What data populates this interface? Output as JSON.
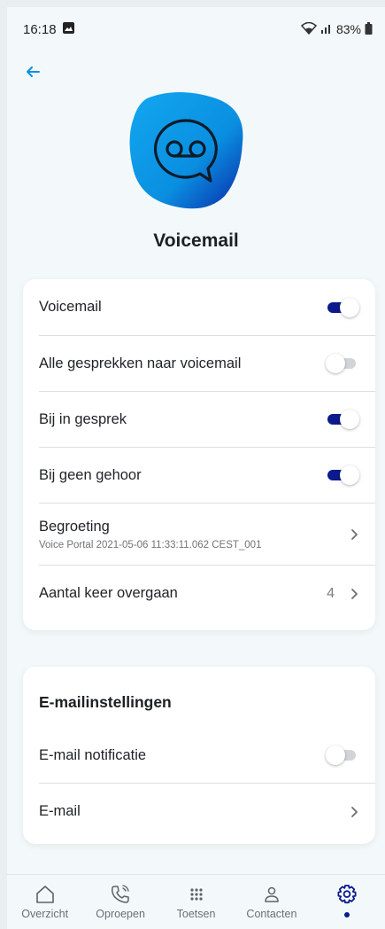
{
  "status_bar": {
    "time": "16:18",
    "battery": "83%",
    "battery_icon": "battery-icon",
    "wifi_icon": "wifi-icon",
    "signal_icon": "signal-icon"
  },
  "header": {
    "title": "Voicemail",
    "back_icon": "arrow-left-icon",
    "hero_icon": "voicemail-icon"
  },
  "voicemail_card": {
    "rows": [
      {
        "label": "Voicemail",
        "control": "toggle",
        "on": true
      },
      {
        "label": "Alle gesprekken naar voicemail",
        "control": "toggle",
        "on": false
      },
      {
        "label": "Bij in gesprek",
        "control": "toggle",
        "on": true
      },
      {
        "label": "Bij geen gehoor",
        "control": "toggle",
        "on": true
      },
      {
        "label": "Begroeting",
        "sublabel": "Voice Portal 2021-05-06 11:33:11.062 CEST_001",
        "control": "chevron"
      },
      {
        "label": "Aantal keer overgaan",
        "value": "4",
        "control": "chevron"
      }
    ]
  },
  "email_card": {
    "title": "E-mailinstellingen",
    "rows": [
      {
        "label": "E-mail notificatie",
        "control": "toggle",
        "on": false
      },
      {
        "label": "E-mail",
        "control": "chevron"
      }
    ]
  },
  "bottom_nav": {
    "items": [
      {
        "label": "Overzicht",
        "icon": "home-icon"
      },
      {
        "label": "Oproepen",
        "icon": "phone-icon"
      },
      {
        "label": "Toetsen",
        "icon": "keypad-icon"
      },
      {
        "label": "Contacten",
        "icon": "contact-icon"
      },
      {
        "label": "",
        "icon": "settings-icon",
        "active": true
      }
    ]
  },
  "colors": {
    "accent": "#0b1a8c",
    "brand_blue": "#0a8fe0",
    "background": "#f3f9fa"
  }
}
